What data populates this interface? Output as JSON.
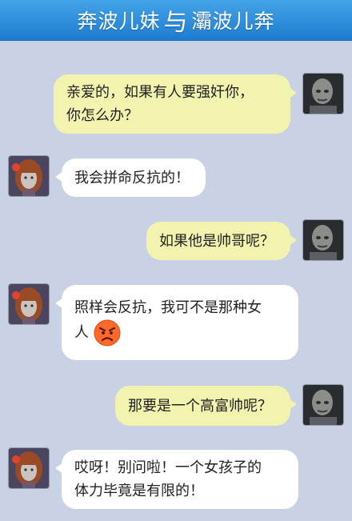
{
  "header": {
    "title_left": "奔波儿妹",
    "title_sep": "与",
    "title_right": "灞波儿奔"
  },
  "messages": [
    {
      "sender": "me",
      "text": "亲爱的，如果有人要强奸你，\n你怎么办？"
    },
    {
      "sender": "her",
      "text": "我会拼命反抗的！"
    },
    {
      "sender": "me",
      "text": "如果他是帅哥呢？"
    },
    {
      "sender": "her",
      "text": "照样会反抗，我可不是那种女\n人",
      "emoji": "angry-face"
    },
    {
      "sender": "me",
      "text": "那要是一个高富帅呢？"
    },
    {
      "sender": "her",
      "text": "哎呀！别问啦！一个女孩子的\n体力毕竟是有限的！"
    }
  ],
  "colors": {
    "background": "#c9d1e4",
    "header": "#2a8ddc",
    "my_bubble": "#f3f3b0",
    "her_bubble": "#ffffff"
  }
}
